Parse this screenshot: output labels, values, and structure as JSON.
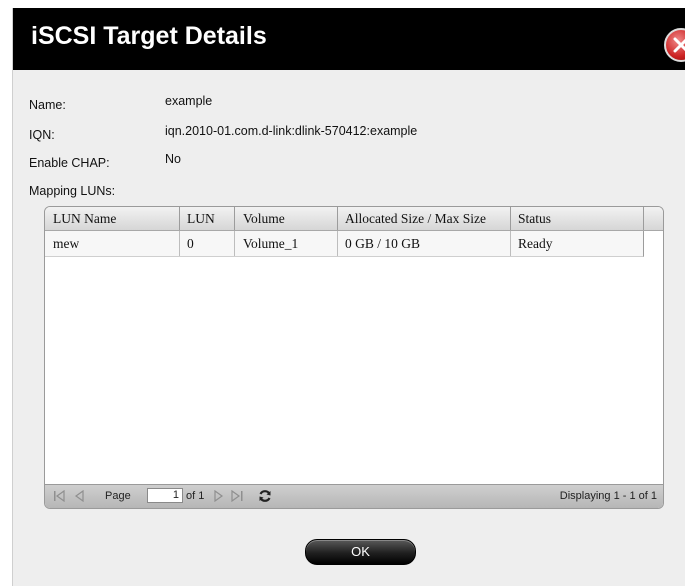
{
  "dialog": {
    "title": "iSCSI Target Details"
  },
  "fields": {
    "name_label": "Name:",
    "name_value": "example",
    "iqn_label": "IQN:",
    "iqn_value": "iqn.2010-01.com.d-link:dlink-570412:example",
    "chap_label": "Enable CHAP:",
    "chap_value": "No",
    "mapping_label": "Mapping LUNs:"
  },
  "table": {
    "columns": [
      "LUN Name",
      "LUN",
      "Volume",
      "Allocated Size / Max Size",
      "Status"
    ],
    "rows": [
      {
        "lun_name": "mew",
        "lun": "0",
        "volume": "Volume_1",
        "size": "0 GB / 10 GB",
        "status": "Ready"
      }
    ]
  },
  "pager": {
    "page_label": "Page",
    "page_value": "1",
    "of_label": "of 1",
    "displaying": "Displaying 1 - 1 of 1"
  },
  "buttons": {
    "ok": "OK"
  },
  "colors": {
    "titlebar": "#000000",
    "dialog_bg": "#eeeeee",
    "close": "#cc2222"
  },
  "icons": [
    "close-icon",
    "first-page-icon",
    "prev-page-icon",
    "next-page-icon",
    "last-page-icon",
    "refresh-icon"
  ]
}
